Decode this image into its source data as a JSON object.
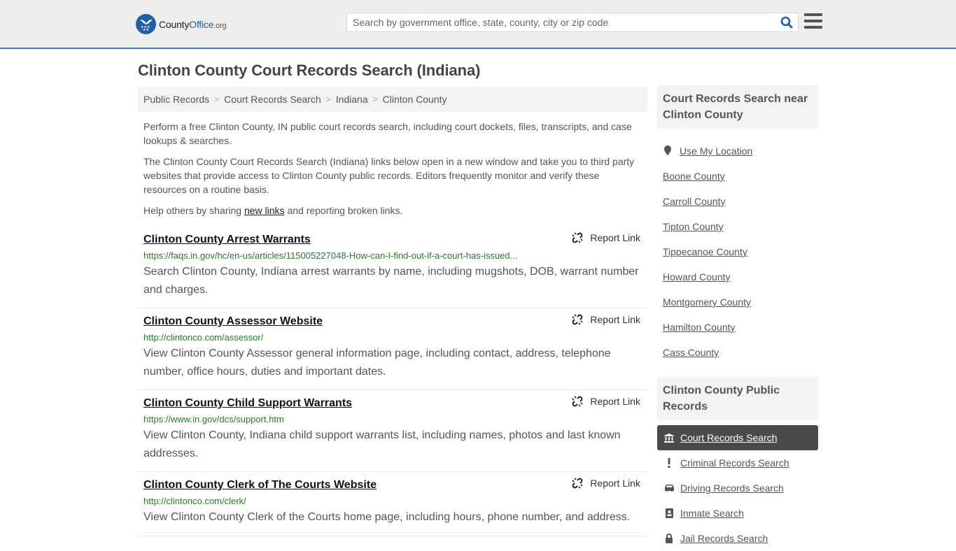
{
  "header": {
    "logo": {
      "name_part1": "County",
      "name_part2": "Office",
      "suffix": ".org"
    },
    "search": {
      "placeholder": "Search by government office, state, county, city or zip code",
      "value": ""
    },
    "colors": {
      "brand": "#1f5fa3",
      "accent_border": "#3a7ab0"
    }
  },
  "page": {
    "title": "Clinton County Court Records Search (Indiana)",
    "breadcrumb": [
      "Public Records",
      "Court Records Search",
      "Indiana",
      "Clinton County"
    ],
    "intro": {
      "p1": "Perform a free Clinton County, IN public court records search, including court dockets, files, transcripts, and case lookups & searches.",
      "p2": "The Clinton County Court Records Search (Indiana) links below open in a new window and take you to third party websites that provide access to Clinton County public records. Editors frequently monitor and verify these resources on a routine basis.",
      "p3_before": "Help others by sharing ",
      "p3_link": "new links",
      "p3_after": " and reporting broken links."
    }
  },
  "results": [
    {
      "title": "Clinton County Arrest Warrants",
      "url": "https://faqs.in.gov/hc/en-us/articles/115005227048-How-can-I-find-out-if-a-court-has-issued...",
      "description": "Search Clinton County, Indiana arrest warrants by name, including mugshots, DOB, warrant number and charges.",
      "report_label": "Report Link"
    },
    {
      "title": "Clinton County Assessor Website",
      "url": "http://clintonco.com/assessor/",
      "description": "View Clinton County Assessor general information page, including contact, address, telephone number, office hours, duties and important dates.",
      "report_label": "Report Link"
    },
    {
      "title": "Clinton County Child Support Warrants",
      "url": "https://www.in.gov/dcs/support.htm",
      "description": "View Clinton County, Indiana child support warrants list, including names, photos and last known addresses.",
      "report_label": "Report Link"
    },
    {
      "title": "Clinton County Clerk of The Courts Website",
      "url": "http://clintonco.com/clerk/",
      "description": "View Clinton County Clerk of the Courts home page, including hours, phone number, and address.",
      "report_label": "Report Link"
    }
  ],
  "sidebar": {
    "nearby_heading": "Court Records Search near Clinton County",
    "use_location": "Use My Location",
    "nearby": [
      "Boone County",
      "Carroll County",
      "Tipton County",
      "Tippecanoe County",
      "Howard County",
      "Montgomery County",
      "Hamilton County",
      "Cass County"
    ],
    "records_heading": "Clinton County Public Records",
    "records": [
      {
        "label": "Court Records Search",
        "icon": "courthouse-icon",
        "active": true
      },
      {
        "label": "Criminal Records Search",
        "icon": "exclamation-icon",
        "active": false
      },
      {
        "label": "Driving Records Search",
        "icon": "car-icon",
        "active": false
      },
      {
        "label": "Inmate Search",
        "icon": "id-badge-icon",
        "active": false
      },
      {
        "label": "Jail Records Search",
        "icon": "lock-icon",
        "active": false
      }
    ]
  }
}
